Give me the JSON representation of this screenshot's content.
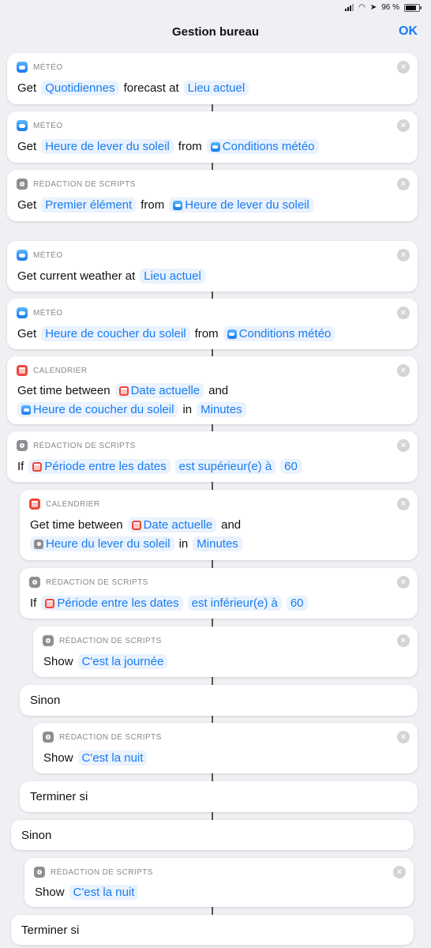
{
  "status": {
    "battery": "96 %"
  },
  "nav": {
    "title": "Gestion bureau",
    "ok": "OK"
  },
  "cats": {
    "meteo": "MÉTÉO",
    "scripts": "RÉDACTION DE SCRIPTS",
    "calendar": "CALENDRIER"
  },
  "words": {
    "get": "Get",
    "forecast_at": "forecast at",
    "from": "from",
    "get_weather_at": "Get current weather at",
    "get_time_between": "Get time between",
    "and": "and",
    "in": "in",
    "if": "If",
    "show": "Show",
    "sinon": "Sinon",
    "terminer_si": "Terminer si"
  },
  "tokens": {
    "quotidiennes": "Quotidiennes",
    "lieu_actuel": "Lieu actuel",
    "lever_soleil": "Heure de lever du soleil",
    "conditions": "Conditions météo",
    "premier": "Premier élément",
    "coucher_soleil": "Heure de coucher du soleil",
    "date_actuelle": "Date actuelle",
    "minutes": "Minutes",
    "periode": "Période entre les dates",
    "superieur": "est supérieur(e) à",
    "inferieur": "est inférieur(e) à",
    "sixty": "60",
    "journee": "C'est la journée",
    "nuit": "C'est la nuit",
    "lever_soleil2": "Heure du lever du soleil"
  },
  "colors": {
    "accent": "#1a7cf0",
    "calendar": "#f0453a",
    "weather": "#1a7cf0",
    "scripts": "#8e8e93"
  }
}
